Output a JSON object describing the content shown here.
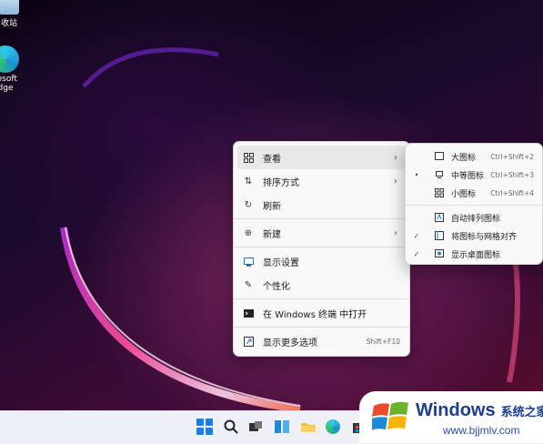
{
  "desktop": {
    "icons": [
      {
        "label": "收站"
      },
      {
        "label": "rosoft\ndge"
      }
    ]
  },
  "context_menu": {
    "items": [
      {
        "label": "查看",
        "icon": "grid-icon",
        "has_submenu": true,
        "highlighted": true
      },
      {
        "label": "排序方式",
        "icon": "sort-icon",
        "has_submenu": true
      },
      {
        "label": "刷新",
        "icon": "refresh-icon"
      },
      {
        "label": "新建",
        "icon": "new-icon",
        "has_submenu": true
      },
      {
        "label": "显示设置",
        "icon": "display-settings-icon"
      },
      {
        "label": "个性化",
        "icon": "brush-icon"
      },
      {
        "label": "在 Windows 终端 中打开",
        "icon": "terminal-icon"
      },
      {
        "label": "显示更多选项",
        "icon": "more-options-icon",
        "shortcut": "Shift+F10"
      }
    ]
  },
  "view_submenu": {
    "items": [
      {
        "label": "大图标",
        "icon": "large-icons-icon",
        "shortcut": "Ctrl+Shift+2",
        "mark": ""
      },
      {
        "label": "中等图标",
        "icon": "medium-icons-icon",
        "shortcut": "Ctrl+Shift+3",
        "mark": "•"
      },
      {
        "label": "小图标",
        "icon": "small-icons-icon",
        "shortcut": "Ctrl+Shift+4",
        "mark": ""
      },
      {
        "label": "自动排列图标",
        "icon": "auto-arrange-icon",
        "mark": ""
      },
      {
        "label": "将图标与网格对齐",
        "icon": "align-grid-icon",
        "mark": "✓"
      },
      {
        "label": "显示桌面图标",
        "icon": "show-desktop-icons-icon",
        "mark": "✓"
      }
    ]
  },
  "taskbar": {
    "icons": [
      "start-icon",
      "search-icon",
      "task-view-icon",
      "widgets-icon",
      "file-explorer-icon",
      "edge-icon",
      "store-icon"
    ]
  },
  "watermark": {
    "title": "Windows",
    "subtitle": "系统之家",
    "url": "www.bjjmlv.com"
  },
  "colors": {
    "accent": "#1a7fe0",
    "menu_bg": "#f9f9f9",
    "watermark_blue": "#1d3c8f"
  }
}
